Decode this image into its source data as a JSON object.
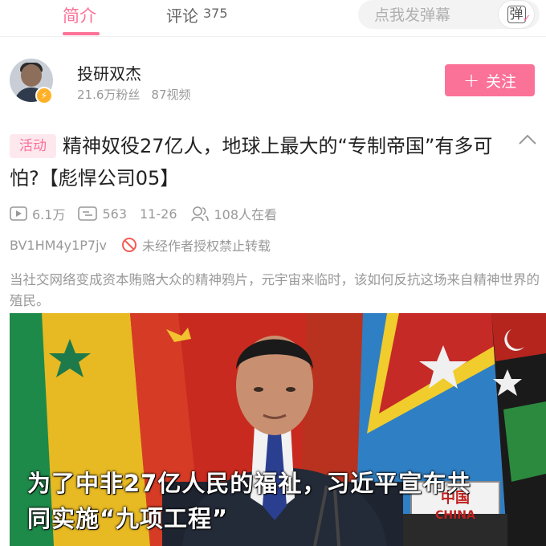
{
  "tabs": {
    "intro_label": "简介",
    "comments_label": "评论",
    "comments_count": "375"
  },
  "danmaku": {
    "placeholder": "点我发弹幕",
    "button_glyph": "弹"
  },
  "uploader": {
    "name": "投研双杰",
    "followers": "21.6万粉丝",
    "videos": "87视频",
    "follow_label": "关注",
    "follow_plus": "+"
  },
  "video": {
    "tag": "活动",
    "title": "精神奴役27亿人，地球上最大的“专制帝国”有多可怕?【彪悍公司05】",
    "views": "6.1万",
    "danmaku_count": "563",
    "date": "11-26",
    "watching": "108人在看",
    "bvid": "BV1HM4y1P7jv",
    "repost_notice": "未经作者授权禁止转载",
    "description": "当社交网络变成资本贿赂大众的精神鸦片，元宇宙来临时，该如何反抗这场来自精神世界的殖民。",
    "caption_line1": "为了中非27亿人民的福祉，习近平宣布共",
    "caption_line2": "同实施“九项工程”",
    "nameplate_cn": "中国",
    "nameplate_en": "CHINA"
  },
  "colors": {
    "accent": "#fb7299",
    "muted_text": "#999999"
  },
  "icons": {
    "views": "play-icon",
    "danmaku": "danmaku-icon",
    "watching": "people-icon",
    "notice": "no-entry-icon",
    "collapse": "chevron-up-icon",
    "verify": "lightning-badge-icon"
  }
}
